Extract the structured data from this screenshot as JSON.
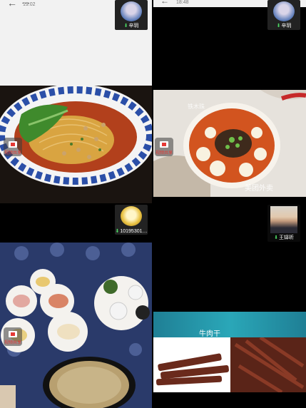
{
  "tiles": [
    {
      "header": {
        "back": "←",
        "title": "…",
        "time": "19:02"
      },
      "participant": {
        "name": "辛玥"
      },
      "badge": {
        "label": "视频共享"
      }
    },
    {
      "header": {
        "back": "←",
        "time": "18:48"
      },
      "participant": {
        "name": "辛玥"
      },
      "badge": {
        "label": "视频共享"
      },
      "watermark": "美团外卖"
    },
    {
      "participant": {
        "name": "10195301…"
      },
      "badge": {
        "label": "视频共享"
      }
    },
    {
      "participant": {
        "name": "王铎昕"
      },
      "caption": "牛肉干"
    }
  ],
  "colors": {
    "mic": "#4cd964",
    "rec": "#e53935",
    "teal_banner": "#2aa7b8"
  }
}
